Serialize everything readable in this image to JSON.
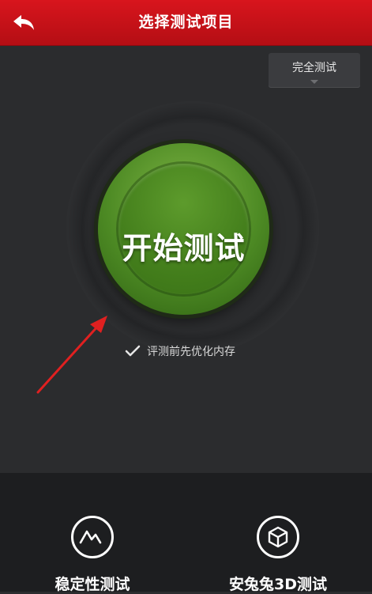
{
  "header": {
    "title": "选择测试项目",
    "back_icon": "back-arrow-icon",
    "color": "#c8121a"
  },
  "mode_select": {
    "selected": "完全测试",
    "icon": "chevron-down-icon"
  },
  "start_button": {
    "label": "开始测试",
    "color": "#4d8a24"
  },
  "optimize_option": {
    "label": "评测前先优化内存",
    "checked": true,
    "icon": "checkmark-icon"
  },
  "annotation": {
    "icon": "red-arrow-icon",
    "color": "#e02020"
  },
  "tools": [
    {
      "label": "稳定性测试",
      "icon": "stability-wave-icon"
    },
    {
      "label": "安兔兔3D测试",
      "icon": "cube-3d-icon"
    }
  ]
}
